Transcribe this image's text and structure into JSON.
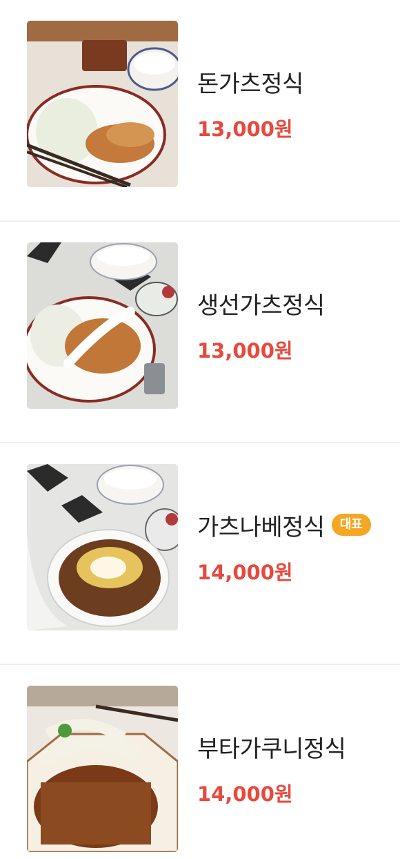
{
  "menu": {
    "items": [
      {
        "name": "돈가츠정식",
        "price": "13,000원",
        "image": "tonkatsu-set-photo"
      },
      {
        "name": "생선가츠정식",
        "price": "13,000원",
        "image": "fish-katsu-set-photo"
      },
      {
        "name": "가츠나베정식",
        "price": "14,000원",
        "badge": "대표",
        "image": "katsu-nabe-set-photo"
      },
      {
        "name": "부타가쿠니정식",
        "price": "14,000원",
        "image": "buta-kakuni-set-photo"
      }
    ]
  },
  "colors": {
    "price": "#e8493d",
    "badge_bg": "#f5a623",
    "divider": "#f0f0f0",
    "name_text": "#222222"
  }
}
